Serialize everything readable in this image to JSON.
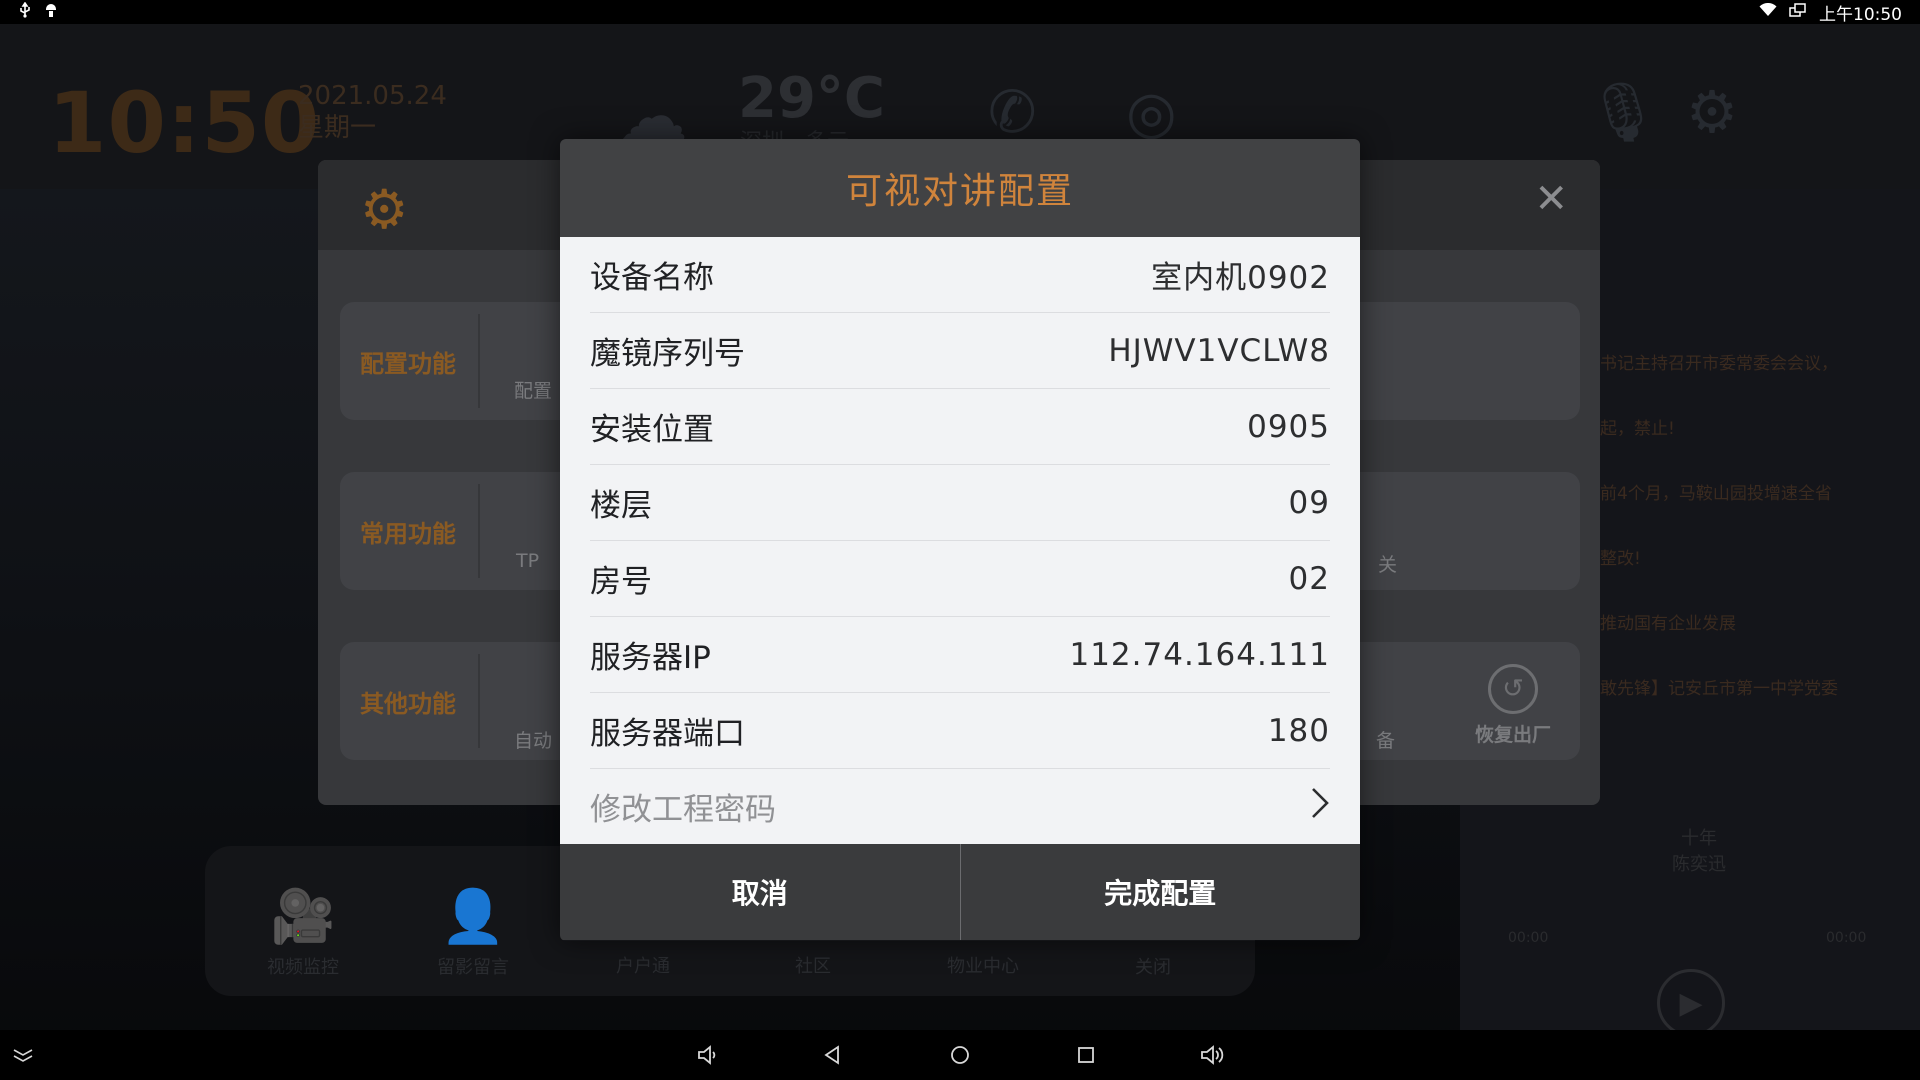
{
  "status_bar": {
    "left_icons": [
      "usb-icon",
      "android-debug-icon"
    ],
    "time": "上午10:50",
    "right_icons": [
      "wifi-icon",
      "multi-window-icon"
    ]
  },
  "home": {
    "clock": "10:50",
    "date": "2021.05.24",
    "weekday": "星期一",
    "temperature": "29°C",
    "city": "深圳",
    "weather": "多云",
    "news": [
      "书记主持召开市委常委会会议，",
      "起，禁止!",
      "前4个月，马鞍山园投增速全省",
      "整改!",
      "推动国有企业发展",
      "敢先锋】记安丘市第一中学党委"
    ],
    "media": {
      "title": "十年",
      "artist": "陈奕迅",
      "time_start": "00:00",
      "time_end": "00:00"
    },
    "dock": [
      "视频监控",
      "留影留言",
      "户户通",
      "社区",
      "物业中心",
      "关闭"
    ]
  },
  "settings": {
    "rows": [
      {
        "label": "配置功能",
        "fragment": "配置"
      },
      {
        "label": "常用功能",
        "fragment": "TP",
        "fragment_right": "关"
      },
      {
        "label": "其他功能",
        "fragment": "自动",
        "fragment_right": "备",
        "reset_label": "恢复出厂"
      }
    ]
  },
  "modal": {
    "title": "可视对讲配置",
    "fields": [
      {
        "label": "设备名称",
        "value": "室内机0902"
      },
      {
        "label": "魔镜序列号",
        "value": "HJWV1VCLW8"
      },
      {
        "label": "安装位置",
        "value": "0905"
      },
      {
        "label": "楼层",
        "value": "09"
      },
      {
        "label": "房号",
        "value": "02"
      },
      {
        "label": "服务器IP",
        "value": "112.74.164.111"
      },
      {
        "label": "服务器端口",
        "value": "180"
      }
    ],
    "change_password_label": "修改工程密码",
    "cancel_label": "取消",
    "confirm_label": "完成配置"
  },
  "colors": {
    "accent": "#d0843c",
    "modal_body": "#f2f3f5",
    "modal_header": "#414244",
    "modal_footer": "#3a3b3d"
  }
}
